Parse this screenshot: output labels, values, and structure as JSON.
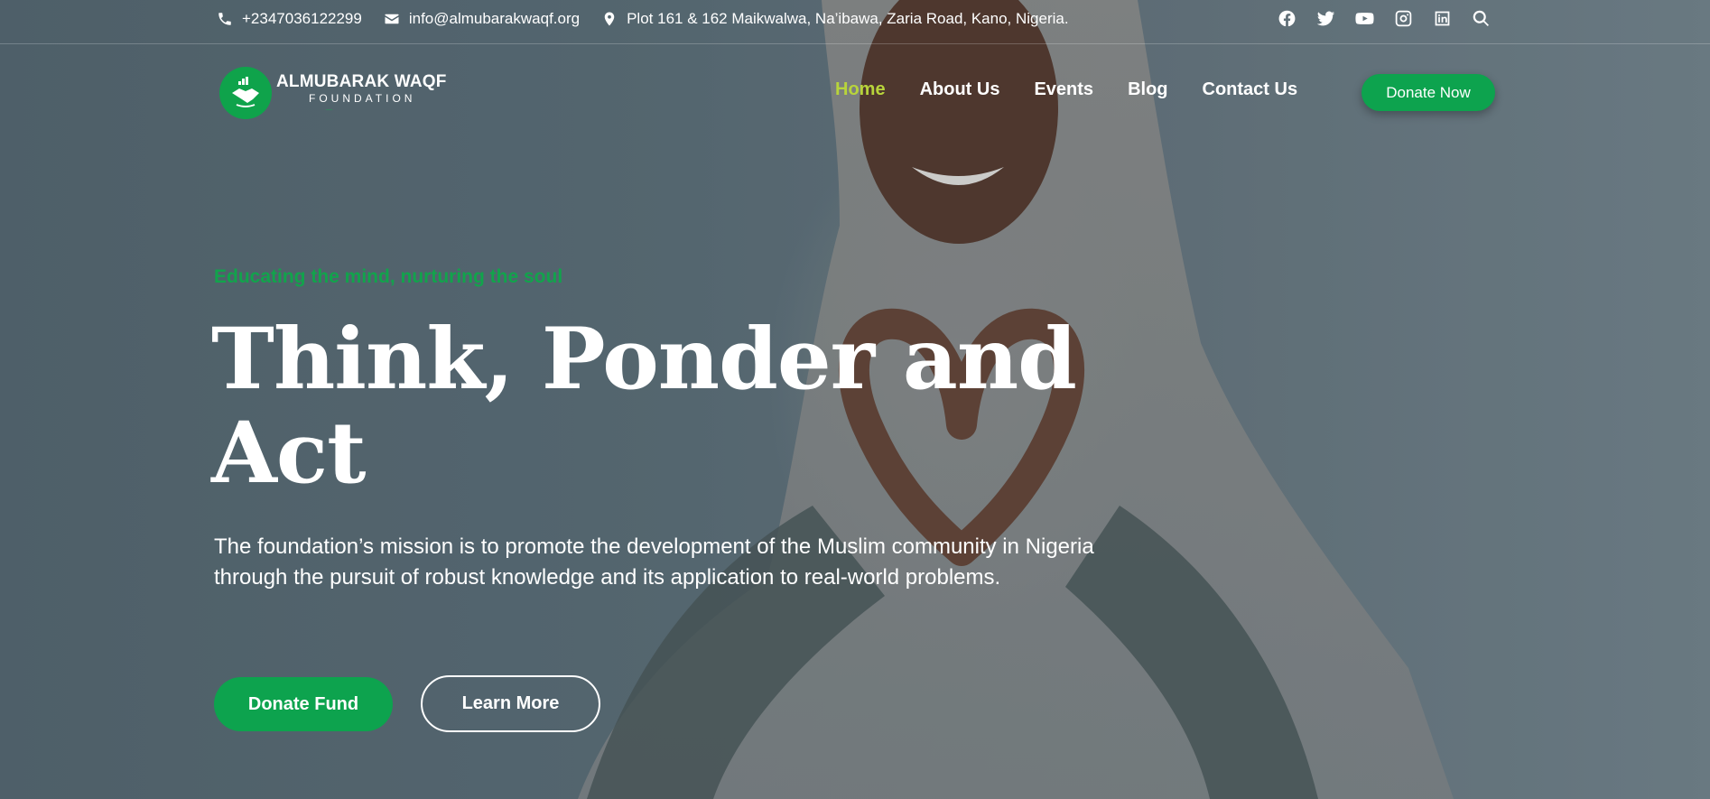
{
  "topbar": {
    "phone": "+2347036122299",
    "email": "info@almubarakwaqf.org",
    "address": "Plot 161 & 162 Maikwalwa, Na’ibawa, Zaria Road, Kano, Nigeria."
  },
  "logo": {
    "title": "ALMUBARAK WAQF",
    "subtitle": "FOUNDATION",
    "tagline": "—"
  },
  "nav": {
    "items": [
      {
        "label": "Home",
        "active": true
      },
      {
        "label": "About Us"
      },
      {
        "label": "Events"
      },
      {
        "label": "Blog"
      },
      {
        "label": "Contact Us"
      }
    ],
    "cta": "Donate Now"
  },
  "hero": {
    "tagline": "Educating the mind, nurturing the soul",
    "headline_line1": "Think, Ponder and",
    "headline_line2": "Act",
    "mission": "The foundation’s mission is to promote the development of the Muslim community in Nigeria through the pursuit of robust knowledge and its application to real-world problems.",
    "primary_button": "Donate Fund",
    "secondary_button": "Learn More"
  },
  "colors": {
    "brand_green": "#0da34e",
    "nav_active": "#b8d43b",
    "tagline_green": "#12a34c"
  }
}
